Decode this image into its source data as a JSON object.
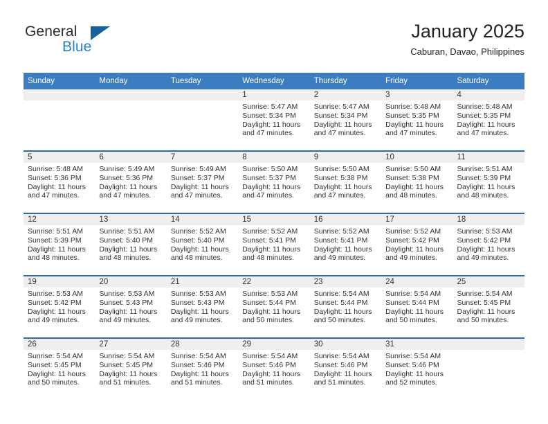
{
  "brand": {
    "name_part1": "General",
    "name_part2": "Blue",
    "triangle_color": "#15639e",
    "blue_color": "#1f7fd4"
  },
  "header": {
    "title": "January 2025",
    "subtitle": "Caburan, Davao, Philippines"
  },
  "theme": {
    "header_blue": "#3b7dc0",
    "rule_blue": "#2b6cb0",
    "daynum_band": "#efefef"
  },
  "weekday_headers": [
    "Sunday",
    "Monday",
    "Tuesday",
    "Wednesday",
    "Thursday",
    "Friday",
    "Saturday"
  ],
  "weeks": [
    [
      {
        "day": "",
        "empty": true,
        "sunrise": "",
        "sunset": "",
        "daylight_line1": "",
        "daylight_line2": ""
      },
      {
        "day": "",
        "empty": true,
        "sunrise": "",
        "sunset": "",
        "daylight_line1": "",
        "daylight_line2": ""
      },
      {
        "day": "",
        "empty": true,
        "sunrise": "",
        "sunset": "",
        "daylight_line1": "",
        "daylight_line2": ""
      },
      {
        "day": "1",
        "empty": false,
        "sunrise": "Sunrise: 5:47 AM",
        "sunset": "Sunset: 5:34 PM",
        "daylight_line1": "Daylight: 11 hours",
        "daylight_line2": "and 47 minutes."
      },
      {
        "day": "2",
        "empty": false,
        "sunrise": "Sunrise: 5:47 AM",
        "sunset": "Sunset: 5:34 PM",
        "daylight_line1": "Daylight: 11 hours",
        "daylight_line2": "and 47 minutes."
      },
      {
        "day": "3",
        "empty": false,
        "sunrise": "Sunrise: 5:48 AM",
        "sunset": "Sunset: 5:35 PM",
        "daylight_line1": "Daylight: 11 hours",
        "daylight_line2": "and 47 minutes."
      },
      {
        "day": "4",
        "empty": false,
        "sunrise": "Sunrise: 5:48 AM",
        "sunset": "Sunset: 5:35 PM",
        "daylight_line1": "Daylight: 11 hours",
        "daylight_line2": "and 47 minutes."
      }
    ],
    [
      {
        "day": "5",
        "empty": false,
        "sunrise": "Sunrise: 5:48 AM",
        "sunset": "Sunset: 5:36 PM",
        "daylight_line1": "Daylight: 11 hours",
        "daylight_line2": "and 47 minutes."
      },
      {
        "day": "6",
        "empty": false,
        "sunrise": "Sunrise: 5:49 AM",
        "sunset": "Sunset: 5:36 PM",
        "daylight_line1": "Daylight: 11 hours",
        "daylight_line2": "and 47 minutes."
      },
      {
        "day": "7",
        "empty": false,
        "sunrise": "Sunrise: 5:49 AM",
        "sunset": "Sunset: 5:37 PM",
        "daylight_line1": "Daylight: 11 hours",
        "daylight_line2": "and 47 minutes."
      },
      {
        "day": "8",
        "empty": false,
        "sunrise": "Sunrise: 5:50 AM",
        "sunset": "Sunset: 5:37 PM",
        "daylight_line1": "Daylight: 11 hours",
        "daylight_line2": "and 47 minutes."
      },
      {
        "day": "9",
        "empty": false,
        "sunrise": "Sunrise: 5:50 AM",
        "sunset": "Sunset: 5:38 PM",
        "daylight_line1": "Daylight: 11 hours",
        "daylight_line2": "and 47 minutes."
      },
      {
        "day": "10",
        "empty": false,
        "sunrise": "Sunrise: 5:50 AM",
        "sunset": "Sunset: 5:38 PM",
        "daylight_line1": "Daylight: 11 hours",
        "daylight_line2": "and 48 minutes."
      },
      {
        "day": "11",
        "empty": false,
        "sunrise": "Sunrise: 5:51 AM",
        "sunset": "Sunset: 5:39 PM",
        "daylight_line1": "Daylight: 11 hours",
        "daylight_line2": "and 48 minutes."
      }
    ],
    [
      {
        "day": "12",
        "empty": false,
        "sunrise": "Sunrise: 5:51 AM",
        "sunset": "Sunset: 5:39 PM",
        "daylight_line1": "Daylight: 11 hours",
        "daylight_line2": "and 48 minutes."
      },
      {
        "day": "13",
        "empty": false,
        "sunrise": "Sunrise: 5:51 AM",
        "sunset": "Sunset: 5:40 PM",
        "daylight_line1": "Daylight: 11 hours",
        "daylight_line2": "and 48 minutes."
      },
      {
        "day": "14",
        "empty": false,
        "sunrise": "Sunrise: 5:52 AM",
        "sunset": "Sunset: 5:40 PM",
        "daylight_line1": "Daylight: 11 hours",
        "daylight_line2": "and 48 minutes."
      },
      {
        "day": "15",
        "empty": false,
        "sunrise": "Sunrise: 5:52 AM",
        "sunset": "Sunset: 5:41 PM",
        "daylight_line1": "Daylight: 11 hours",
        "daylight_line2": "and 48 minutes."
      },
      {
        "day": "16",
        "empty": false,
        "sunrise": "Sunrise: 5:52 AM",
        "sunset": "Sunset: 5:41 PM",
        "daylight_line1": "Daylight: 11 hours",
        "daylight_line2": "and 49 minutes."
      },
      {
        "day": "17",
        "empty": false,
        "sunrise": "Sunrise: 5:52 AM",
        "sunset": "Sunset: 5:42 PM",
        "daylight_line1": "Daylight: 11 hours",
        "daylight_line2": "and 49 minutes."
      },
      {
        "day": "18",
        "empty": false,
        "sunrise": "Sunrise: 5:53 AM",
        "sunset": "Sunset: 5:42 PM",
        "daylight_line1": "Daylight: 11 hours",
        "daylight_line2": "and 49 minutes."
      }
    ],
    [
      {
        "day": "19",
        "empty": false,
        "sunrise": "Sunrise: 5:53 AM",
        "sunset": "Sunset: 5:42 PM",
        "daylight_line1": "Daylight: 11 hours",
        "daylight_line2": "and 49 minutes."
      },
      {
        "day": "20",
        "empty": false,
        "sunrise": "Sunrise: 5:53 AM",
        "sunset": "Sunset: 5:43 PM",
        "daylight_line1": "Daylight: 11 hours",
        "daylight_line2": "and 49 minutes."
      },
      {
        "day": "21",
        "empty": false,
        "sunrise": "Sunrise: 5:53 AM",
        "sunset": "Sunset: 5:43 PM",
        "daylight_line1": "Daylight: 11 hours",
        "daylight_line2": "and 49 minutes."
      },
      {
        "day": "22",
        "empty": false,
        "sunrise": "Sunrise: 5:53 AM",
        "sunset": "Sunset: 5:44 PM",
        "daylight_line1": "Daylight: 11 hours",
        "daylight_line2": "and 50 minutes."
      },
      {
        "day": "23",
        "empty": false,
        "sunrise": "Sunrise: 5:54 AM",
        "sunset": "Sunset: 5:44 PM",
        "daylight_line1": "Daylight: 11 hours",
        "daylight_line2": "and 50 minutes."
      },
      {
        "day": "24",
        "empty": false,
        "sunrise": "Sunrise: 5:54 AM",
        "sunset": "Sunset: 5:44 PM",
        "daylight_line1": "Daylight: 11 hours",
        "daylight_line2": "and 50 minutes."
      },
      {
        "day": "25",
        "empty": false,
        "sunrise": "Sunrise: 5:54 AM",
        "sunset": "Sunset: 5:45 PM",
        "daylight_line1": "Daylight: 11 hours",
        "daylight_line2": "and 50 minutes."
      }
    ],
    [
      {
        "day": "26",
        "empty": false,
        "sunrise": "Sunrise: 5:54 AM",
        "sunset": "Sunset: 5:45 PM",
        "daylight_line1": "Daylight: 11 hours",
        "daylight_line2": "and 50 minutes."
      },
      {
        "day": "27",
        "empty": false,
        "sunrise": "Sunrise: 5:54 AM",
        "sunset": "Sunset: 5:45 PM",
        "daylight_line1": "Daylight: 11 hours",
        "daylight_line2": "and 51 minutes."
      },
      {
        "day": "28",
        "empty": false,
        "sunrise": "Sunrise: 5:54 AM",
        "sunset": "Sunset: 5:46 PM",
        "daylight_line1": "Daylight: 11 hours",
        "daylight_line2": "and 51 minutes."
      },
      {
        "day": "29",
        "empty": false,
        "sunrise": "Sunrise: 5:54 AM",
        "sunset": "Sunset: 5:46 PM",
        "daylight_line1": "Daylight: 11 hours",
        "daylight_line2": "and 51 minutes."
      },
      {
        "day": "30",
        "empty": false,
        "sunrise": "Sunrise: 5:54 AM",
        "sunset": "Sunset: 5:46 PM",
        "daylight_line1": "Daylight: 11 hours",
        "daylight_line2": "and 51 minutes."
      },
      {
        "day": "31",
        "empty": false,
        "sunrise": "Sunrise: 5:54 AM",
        "sunset": "Sunset: 5:46 PM",
        "daylight_line1": "Daylight: 11 hours",
        "daylight_line2": "and 52 minutes."
      },
      {
        "day": "",
        "empty": true,
        "sunrise": "",
        "sunset": "",
        "daylight_line1": "",
        "daylight_line2": ""
      }
    ]
  ]
}
